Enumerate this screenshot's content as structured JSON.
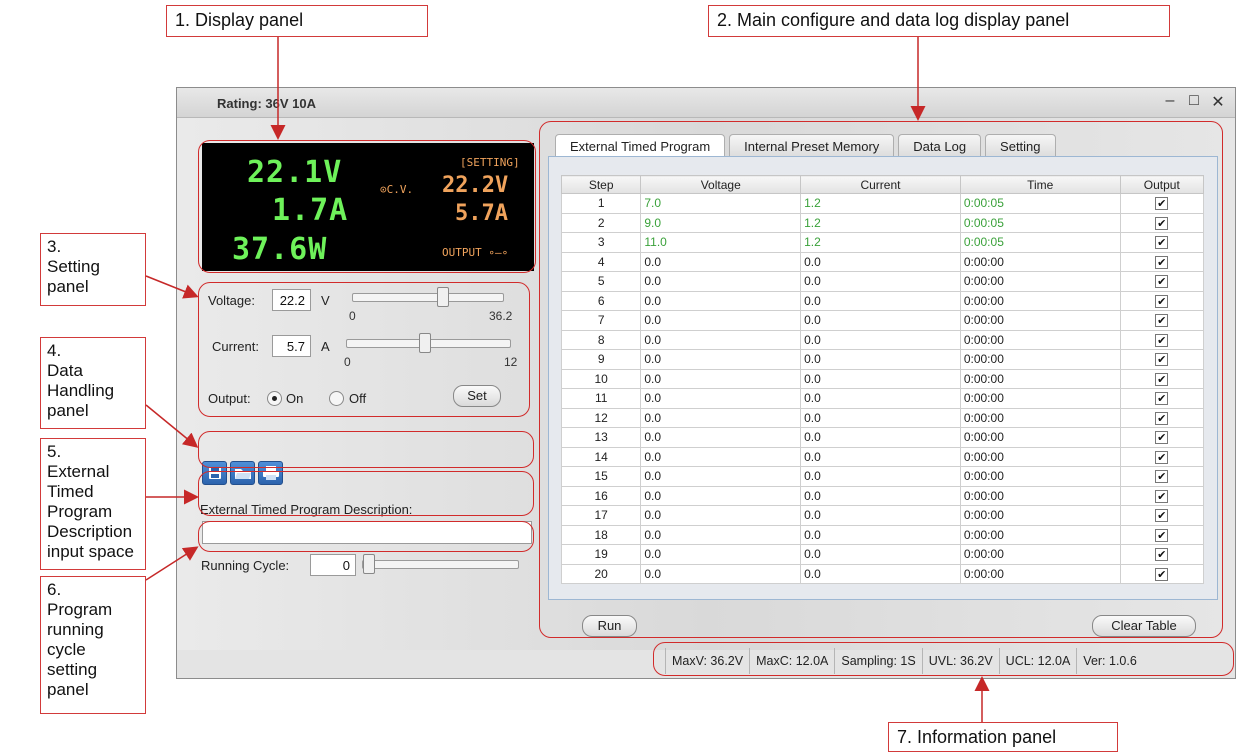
{
  "callouts": {
    "c1": "1. Display panel",
    "c2": "2. Main configure and data log display  panel",
    "c3": "3.\nSetting\npanel",
    "c4": "4.\nData\nHandling\npanel",
    "c5": "5.\nExternal\nTimed\nProgram\nDescription\ninput space",
    "c6": "6.\nProgram\nrunning\ncycle\nsetting\npanel",
    "c7": "7. Information panel"
  },
  "window": {
    "title": "Rating: 36V 10A",
    "controls": [
      "–",
      "□",
      "✕"
    ]
  },
  "display": {
    "voltage": "22.1V",
    "current": "1.7A",
    "power": "37.6W",
    "mode": "⊙C.V.",
    "setting_label": "[SETTING]",
    "set_voltage": "22.2V",
    "set_current": "5.7A",
    "output_label": "OUTPUT ∘–∘"
  },
  "setting": {
    "voltage_label": "Voltage:",
    "voltage_value": "22.2",
    "voltage_unit": "V",
    "voltage_min": "0",
    "voltage_max": "36.2",
    "voltage_level": 0.61,
    "current_label": "Current:",
    "current_value": "5.7",
    "current_unit": "A",
    "current_min": "0",
    "current_max": "12",
    "current_level": 0.48,
    "output_label": "Output:",
    "on_label": "On",
    "off_label": "Off",
    "set_button": "Set"
  },
  "toolbar": [
    "save-icon",
    "open-folder-icon",
    "print-icon"
  ],
  "description_label": "External Timed Program Description:",
  "running_cycle": {
    "label": "Running Cycle:",
    "value": "0",
    "level": 0
  },
  "tabs": [
    "External Timed Program",
    "Internal Preset Memory",
    "Data Log",
    "Setting"
  ],
  "table": {
    "headers": [
      "Step",
      "Voltage",
      "Current",
      "Time",
      "Output"
    ],
    "rows": [
      [
        "1",
        "7.0",
        "1.2",
        "0:00:05"
      ],
      [
        "2",
        "9.0",
        "1.2",
        "0:00:05"
      ],
      [
        "3",
        "11.0",
        "1.2",
        "0:00:05"
      ],
      [
        "4",
        "0.0",
        "0.0",
        "0:00:00"
      ],
      [
        "5",
        "0.0",
        "0.0",
        "0:00:00"
      ],
      [
        "6",
        "0.0",
        "0.0",
        "0:00:00"
      ],
      [
        "7",
        "0.0",
        "0.0",
        "0:00:00"
      ],
      [
        "8",
        "0.0",
        "0.0",
        "0:00:00"
      ],
      [
        "9",
        "0.0",
        "0.0",
        "0:00:00"
      ],
      [
        "10",
        "0.0",
        "0.0",
        "0:00:00"
      ],
      [
        "11",
        "0.0",
        "0.0",
        "0:00:00"
      ],
      [
        "12",
        "0.0",
        "0.0",
        "0:00:00"
      ],
      [
        "13",
        "0.0",
        "0.0",
        "0:00:00"
      ],
      [
        "14",
        "0.0",
        "0.0",
        "0:00:00"
      ],
      [
        "15",
        "0.0",
        "0.0",
        "0:00:00"
      ],
      [
        "16",
        "0.0",
        "0.0",
        "0:00:00"
      ],
      [
        "17",
        "0.0",
        "0.0",
        "0:00:00"
      ],
      [
        "18",
        "0.0",
        "0.0",
        "0:00:00"
      ],
      [
        "19",
        "0.0",
        "0.0",
        "0:00:00"
      ],
      [
        "20",
        "0.0",
        "0.0",
        "0:00:00"
      ]
    ],
    "output_checked": true
  },
  "buttons": {
    "run": "Run",
    "clear": "Clear Table"
  },
  "status": [
    "MaxV: 36.2V",
    "MaxC: 12.0A",
    "Sampling: 1S",
    "UVL: 36.2V",
    "UCL: 12.0A",
    "Ver: 1.0.6"
  ],
  "colors": {
    "display_green": "#6ef25a",
    "display_orange": "#f0a35c",
    "annotation_red": "#d12b2b"
  }
}
